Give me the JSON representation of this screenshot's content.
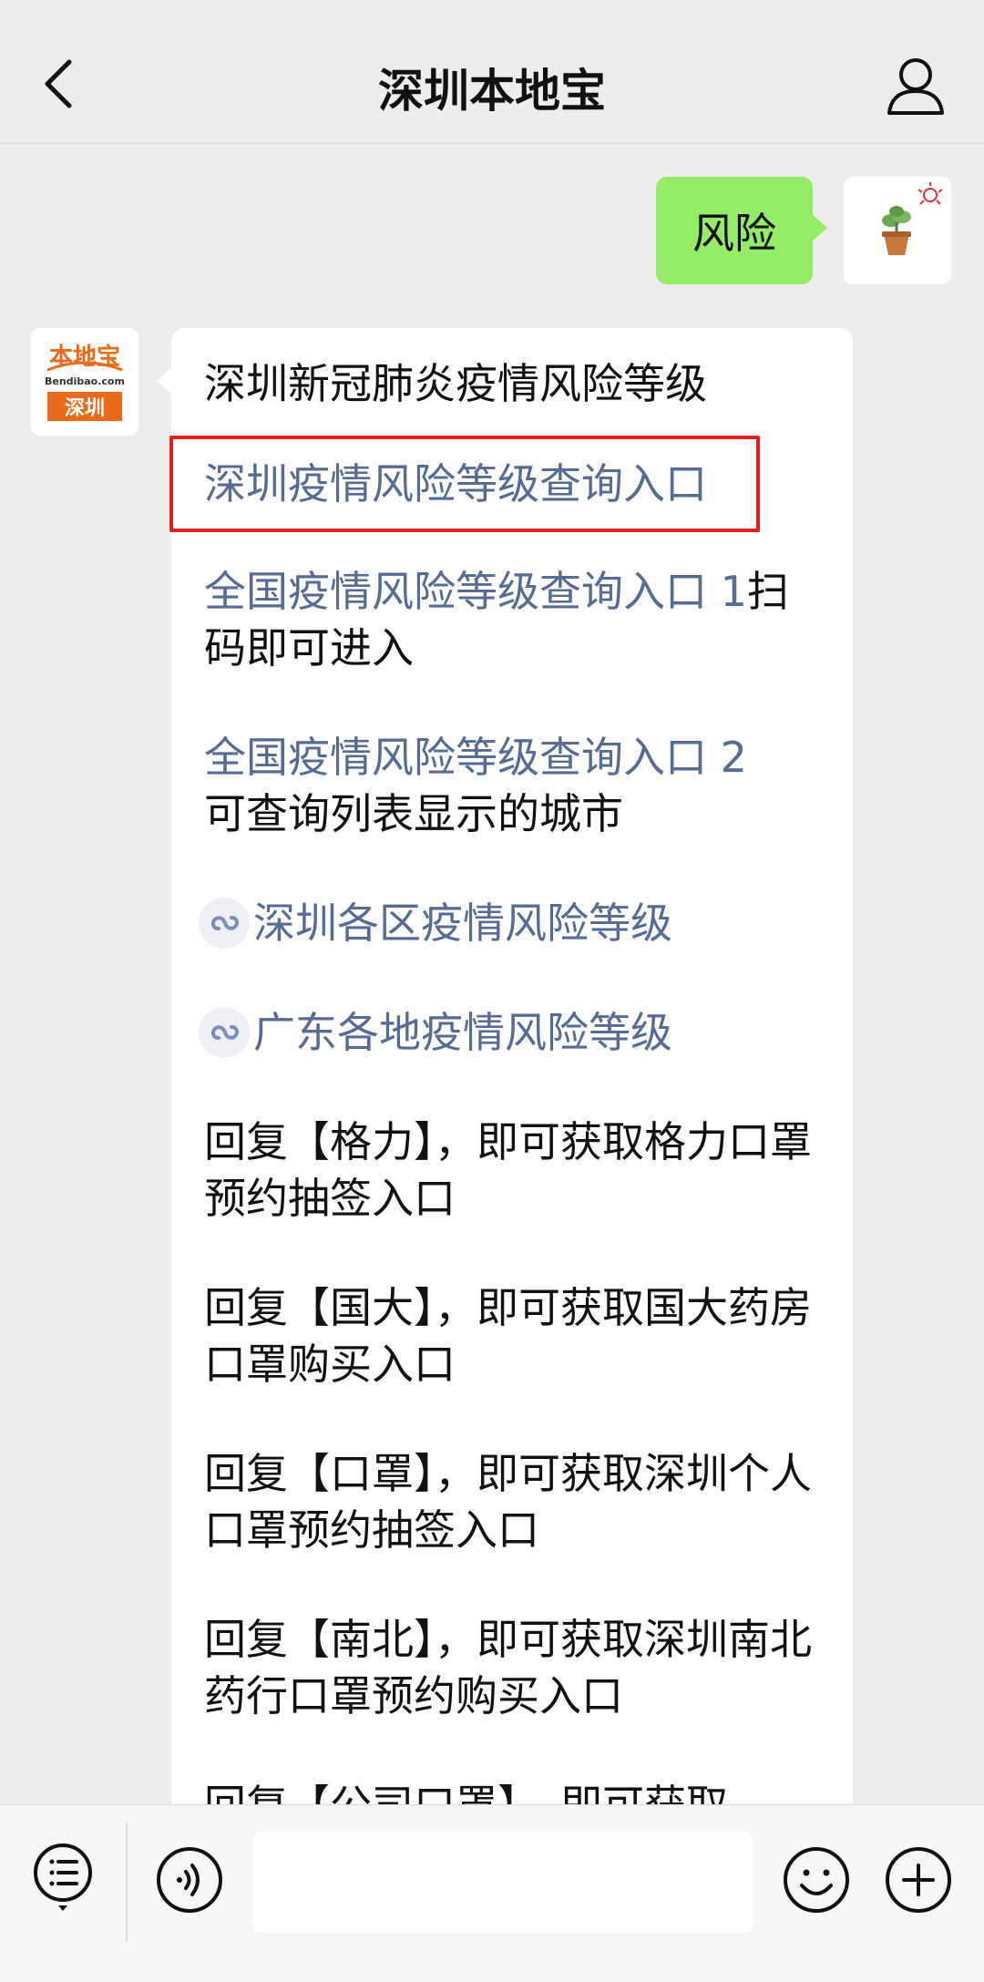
{
  "header": {
    "title": "深圳本地宝",
    "back_icon": "chevron-left-icon",
    "profile_icon": "person-icon"
  },
  "user_message": {
    "text": "风险"
  },
  "bot_avatar": {
    "logo_text": "本地宝",
    "logo_sub": "Bendibao.com",
    "logo_city": "深圳"
  },
  "bot_message": {
    "heading": "深圳新冠肺炎疫情风险等级",
    "highlighted_link": "深圳疫情风险等级查询入口",
    "items": [
      {
        "link": "全国疫情风险等级查询入口 1",
        "text": "扫码即可进入"
      },
      {
        "link": "全国疫情风险等级查询入口 2",
        "text": "可查询列表显示的城市"
      }
    ],
    "mini_links": [
      "深圳各区疫情风险等级",
      "广东各地疫情风险等级"
    ],
    "replies": [
      "回复【格力】，即可获取格力口罩预约抽签入口",
      "回复【国大】，即可获取国大药房口罩购买入口",
      "回复【口罩】，即可获取深圳个人口罩预约抽签入口",
      "回复【南北】，即可获取深圳南北药行口罩预约购买入口",
      "回复【公司口罩】，即可获取"
    ]
  },
  "colors": {
    "background": "#ededed",
    "user_bubble": "#95ec69",
    "link": "#576b95",
    "highlight": "#e02020",
    "logo_orange": "#e86a1a"
  },
  "input_bar": {
    "menu_icon": "menu-list-icon",
    "voice_icon": "voice-icon",
    "emoji_icon": "emoji-icon",
    "plus_icon": "plus-icon",
    "value": ""
  }
}
